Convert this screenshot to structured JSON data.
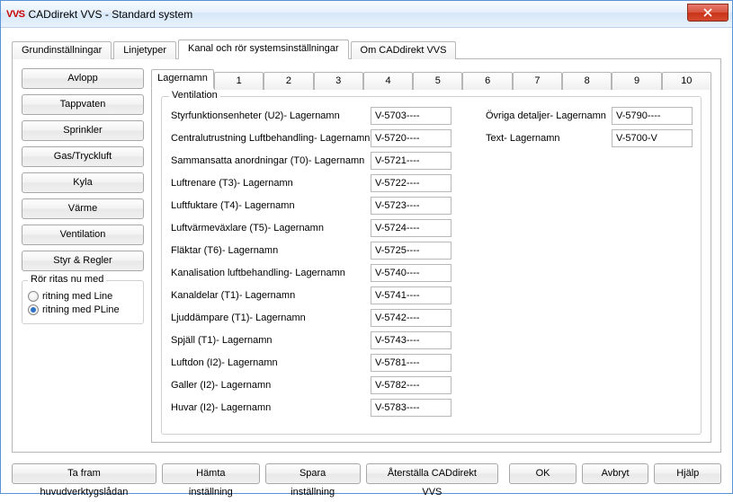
{
  "window": {
    "logo": "VVS",
    "title": "CADdirekt VVS - Standard system"
  },
  "outer_tabs": [
    {
      "label": "Grundinställningar",
      "active": false
    },
    {
      "label": "Linjetyper",
      "active": false
    },
    {
      "label": "Kanal och rör systemsinställningar",
      "active": true
    },
    {
      "label": "Om CADdirekt VVS",
      "active": false
    }
  ],
  "sidebar": {
    "buttons": [
      "Avlopp",
      "Tappvaten",
      "Sprinkler",
      "Gas/Tryckluft",
      "Kyla",
      "Värme",
      "Ventilation",
      "Styr & Regler"
    ],
    "group_label": "Rör ritas nu med",
    "radios": [
      {
        "label": "ritning med Line",
        "checked": false
      },
      {
        "label": "ritning med PLine",
        "checked": true
      }
    ]
  },
  "inner_tabs": [
    "Lagernamn",
    "1",
    "2",
    "3",
    "4",
    "5",
    "6",
    "7",
    "8",
    "9",
    "10"
  ],
  "inner_active": 0,
  "fieldset_label": "Ventilation",
  "left_rows": [
    {
      "label": "Styrfunktionsenheter (U2)- Lagernamn",
      "value": "V-5703----"
    },
    {
      "label": "Centralutrustning Luftbehandling- Lagernamn",
      "value": "V-5720----"
    },
    {
      "label": "Sammansatta anordningar (T0)- Lagernamn",
      "value": "V-5721----"
    },
    {
      "label": "Luftrenare (T3)- Lagernamn",
      "value": "V-5722----"
    },
    {
      "label": "Luftfuktare (T4)- Lagernamn",
      "value": "V-5723----"
    },
    {
      "label": "Luftvärmeväxlare (T5)- Lagernamn",
      "value": "V-5724----"
    },
    {
      "label": "Fläktar (T6)- Lagernamn",
      "value": "V-5725----"
    },
    {
      "label": "Kanalisation luftbehandling- Lagernamn",
      "value": "V-5740----"
    },
    {
      "label": "Kanaldelar (T1)- Lagernamn",
      "value": "V-5741----"
    },
    {
      "label": "Ljuddämpare (T1)- Lagernamn",
      "value": "V-5742----"
    },
    {
      "label": "Spjäll (T1)- Lagernamn",
      "value": "V-5743----"
    },
    {
      "label": "Luftdon (I2)- Lagernamn",
      "value": "V-5781----"
    },
    {
      "label": "Galler (I2)- Lagernamn",
      "value": "V-5782----"
    },
    {
      "label": "Huvar (I2)- Lagernamn",
      "value": "V-5783----"
    }
  ],
  "right_rows": [
    {
      "label": "Övriga detaljer- Lagernamn",
      "value": "V-5790----"
    },
    {
      "label": "Text- Lagernamn",
      "value": "V-5700-V"
    }
  ],
  "bottom": {
    "left": [
      "Ta fram huvudverktygslådan",
      "Hämta inställning",
      "Spara inställning",
      "Återställa CADdirekt VVS"
    ],
    "right": [
      "OK",
      "Avbryt",
      "Hjälp"
    ]
  }
}
